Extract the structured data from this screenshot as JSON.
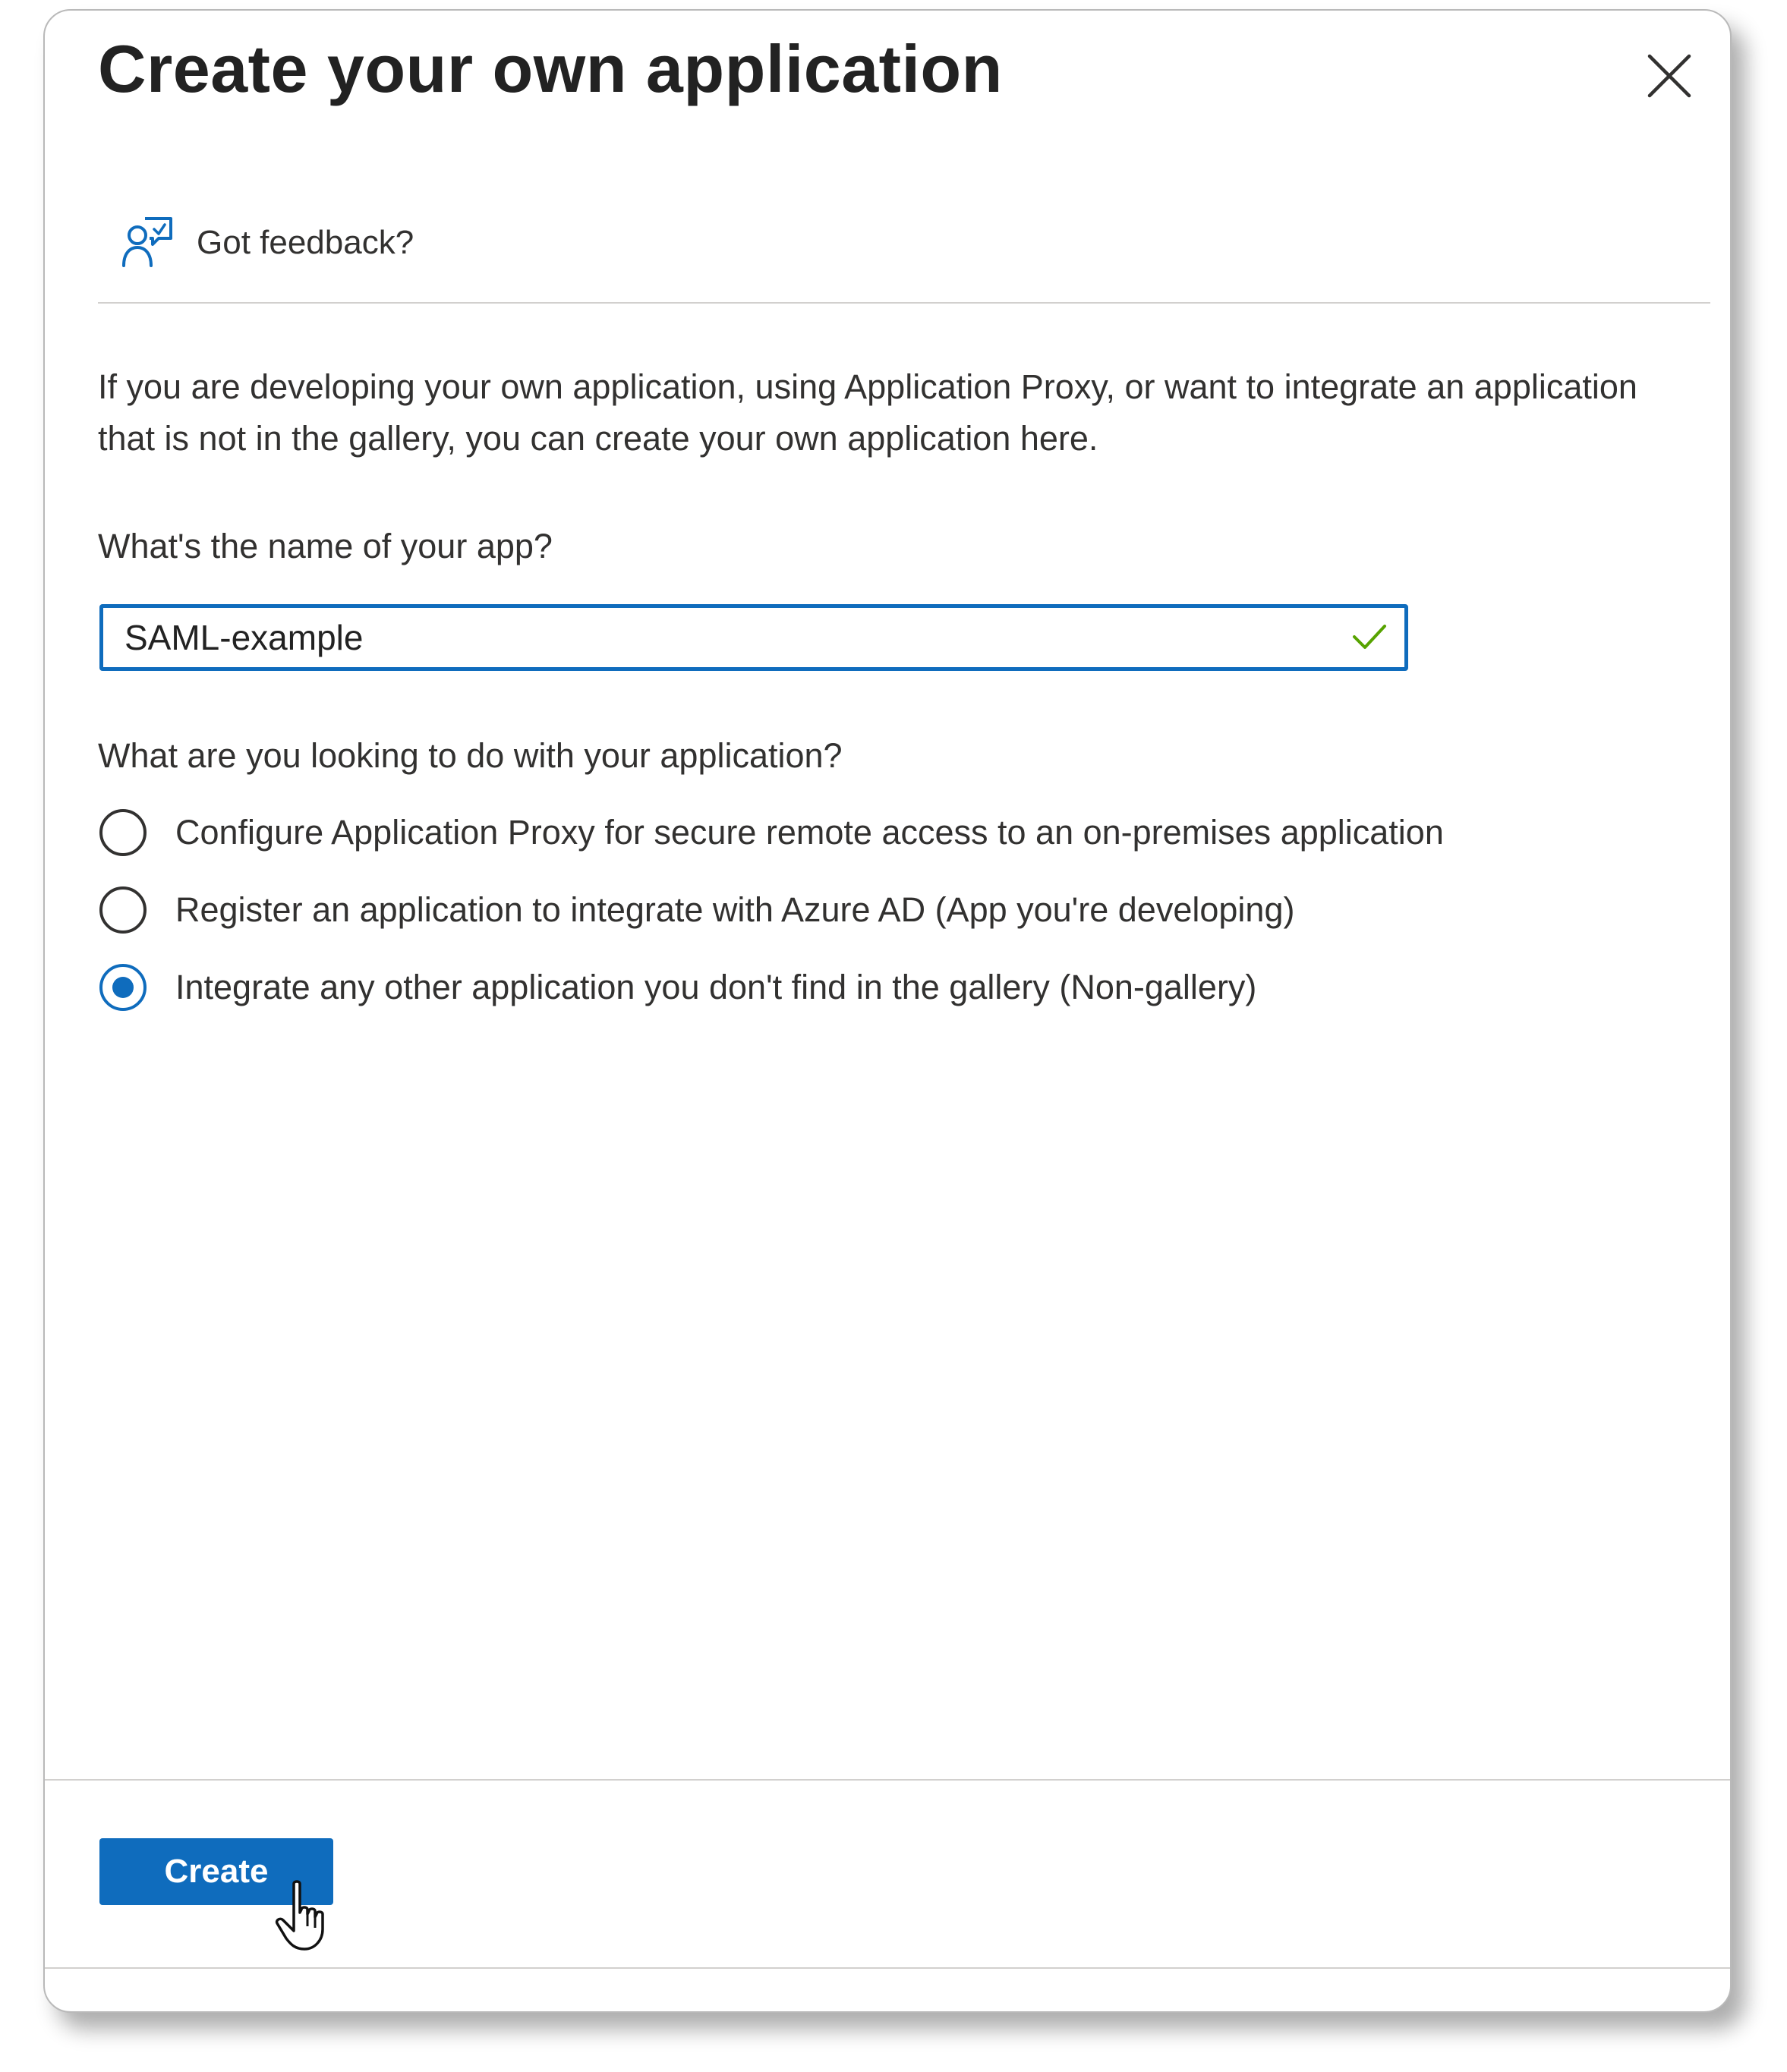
{
  "dialog": {
    "title": "Create your own application",
    "close_icon": "close-icon"
  },
  "feedback": {
    "icon": "feedback-person-icon",
    "label": "Got feedback?"
  },
  "description": "If you are developing your own application, using Application Proxy, or want to integrate an application that is not in the gallery, you can create your own application here.",
  "app_name": {
    "label": "What's the name of your app?",
    "value": "SAML-example",
    "valid_icon": "checkmark-icon"
  },
  "purpose": {
    "label": "What are you looking to do with your application?",
    "options": [
      {
        "label": "Configure Application Proxy for secure remote access to an on-premises application",
        "selected": false
      },
      {
        "label": "Register an application to integrate with Azure AD (App you're developing)",
        "selected": false
      },
      {
        "label": "Integrate any other application you don't find in the gallery (Non-gallery)",
        "selected": true
      }
    ]
  },
  "footer": {
    "create_label": "Create",
    "cursor_icon": "hand-pointer-cursor-icon"
  },
  "colors": {
    "accent": "#0f6cbd",
    "valid": "#57a300",
    "text": "#323130",
    "divider": "#d2d0ce"
  }
}
